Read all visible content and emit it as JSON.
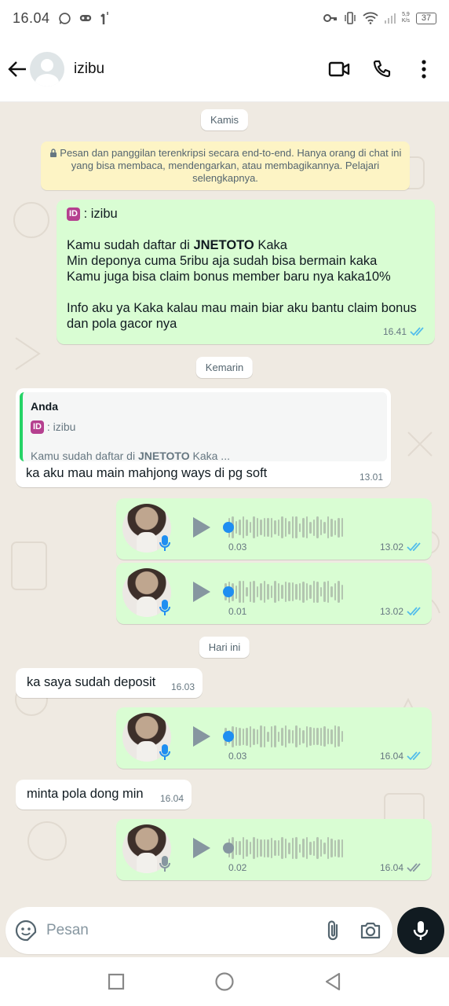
{
  "status_bar": {
    "time": "16.04",
    "net_speed_value": "5,9",
    "net_speed_unit": "K/s",
    "battery": "37"
  },
  "header": {
    "contact_name": "izibu"
  },
  "dates": {
    "thursday": "Kamis",
    "yesterday": "Kemarin",
    "today": "Hari ini"
  },
  "e2e_notice": "Pesan dan panggilan terenkripsi secara end-to-end. Hanya orang di chat ini yang bisa membaca, mendengarkan, atau membagikannya. Pelajari selengkapnya.",
  "messages": {
    "m1": {
      "badge": "ID",
      "name_line": " : izibu",
      "line1_pre": "Kamu sudah daftar di ",
      "line1_bold": "JNETOTO",
      "line1_post": " Kaka",
      "line2": "Min deponya cuma 5ribu aja sudah bisa bermain kaka",
      "line3": "Kamu juga bisa claim bonus member baru nya kaka10%",
      "line4": "Info aku ya Kaka kalau mau main biar aku bantu claim bonus dan pola gacor nya",
      "time": "16.41"
    },
    "m2": {
      "quote_author": "Anda",
      "quote_badge": "ID",
      "quote_name_line": " : izibu",
      "quote_text_pre": "Kamu sudah daftar di ",
      "quote_text_bold": "JNETOTO",
      "quote_text_post": " Kaka ...",
      "text": "ka aku mau main mahjong ways di pg soft",
      "time": "13.01"
    },
    "v1": {
      "duration": "0.03",
      "time": "13.02"
    },
    "v2": {
      "duration": "0.01",
      "time": "13.02"
    },
    "m3": {
      "text": "ka saya sudah deposit",
      "time": "16.03"
    },
    "v3": {
      "duration": "0.03",
      "time": "16.04"
    },
    "m4": {
      "text": "minta pola dong min",
      "time": "16.04"
    },
    "v4": {
      "duration": "0.02",
      "time": "16.04"
    }
  },
  "input": {
    "placeholder": "Pesan"
  },
  "colors": {
    "read_tick": "#53bdeb",
    "sent_tick": "#8696a0",
    "voice_dot_played": "#1f8ef1",
    "voice_dot_unplayed": "#8696a0",
    "outgoing_bubble": "#d9fdd3"
  }
}
